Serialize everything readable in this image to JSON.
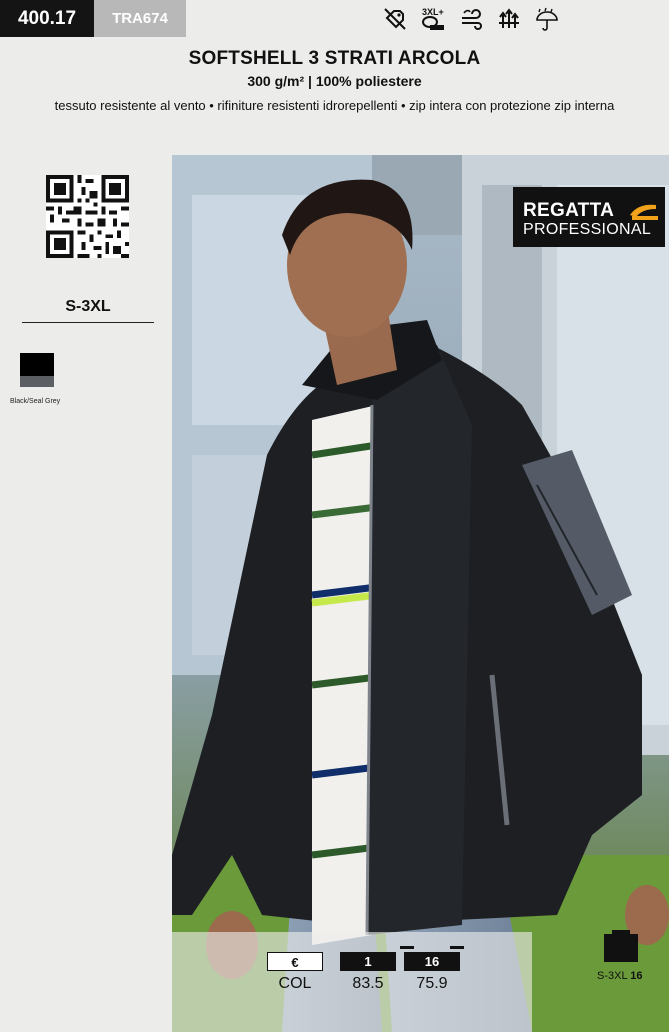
{
  "header": {
    "code": "400.17",
    "reference": "TRA674",
    "icons": [
      "shirt-no-tag-icon",
      "size-3xl-plus-measure-icon",
      "windproof-icon",
      "breathable-icon",
      "water-repellent-umbrella-icon"
    ],
    "icon_3xl_text": "3XL+"
  },
  "product": {
    "title": "SOFTSHELL 3 STRATI ARCOLA",
    "subtitle": "300 g/m² | 100% poliestere",
    "features": "tessuto resistente al vento • rifiniture resistenti idrorepellenti • zip intera con protezione zip interna"
  },
  "sidebar": {
    "sizes": "S-3XL",
    "colors": [
      {
        "name": "Black/Seal Grey",
        "primary": "#000000",
        "secondary": "#5b5e62"
      }
    ]
  },
  "brand": {
    "line1": "REGATTA",
    "line2": "PROFESSIONAL"
  },
  "pricing": {
    "columns": [
      {
        "header": "€",
        "value": "COL"
      },
      {
        "header": "1",
        "value": "83.5"
      },
      {
        "header": "16",
        "value": "75.9"
      }
    ]
  },
  "packing": {
    "size_range": "S-3XL",
    "quantity": "16"
  }
}
